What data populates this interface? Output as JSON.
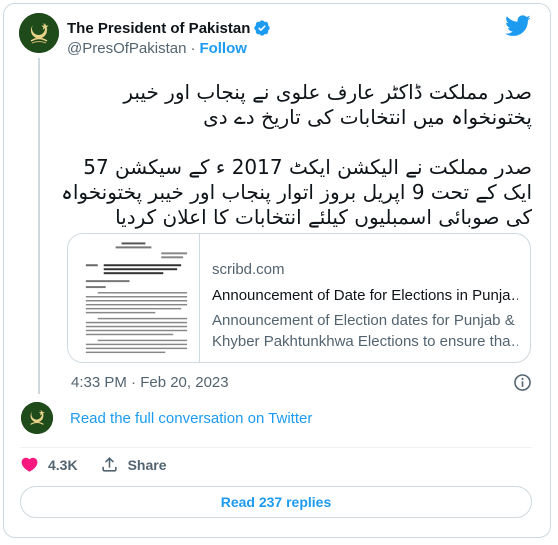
{
  "tweet": {
    "author": {
      "display_name": "The President of Pakistan",
      "handle": "@PresOfPakistan",
      "separator": "·",
      "follow_label": "Follow",
      "verified": true
    },
    "text_paragraphs": [
      "صدر مملکت ڈاکٹر عارف علوی نے پنجاب اور خیبر پختونخواہ میں انتخابات کی تاریخ دے دی",
      "صدر مملکت نے الیکشن ایکٹ 2017 ء کے سیکشن 57 ایک کے تحت 9 اپریل بروز اتوار پنجاب اور خیبر پختونخواہ کی صوبائی اسمبلیوں کیلئے انتخابات کا اعلان کردیا"
    ],
    "link_card": {
      "domain": "scribd.com",
      "title": "Announcement of Date for Elections in Punja…",
      "description_line1": "Announcement of Election dates for Punjab &",
      "description_line2": "Khyber Pakhtunkhwa Elections to ensure tha…"
    },
    "timestamp": "4:33 PM · Feb 20, 2023",
    "read_conversation_label": "Read the full conversation on Twitter",
    "actions": {
      "like_count": "4.3K",
      "share_label": "Share"
    },
    "read_replies_label": "Read 237 replies"
  },
  "colors": {
    "accent": "#1d9bf0",
    "heart": "#f91880",
    "muted": "#536471",
    "avatar_bg": "#1f4a1a"
  },
  "icons": [
    "twitter-bird-icon",
    "verified-badge-icon",
    "info-icon",
    "heart-icon",
    "share-icon"
  ]
}
